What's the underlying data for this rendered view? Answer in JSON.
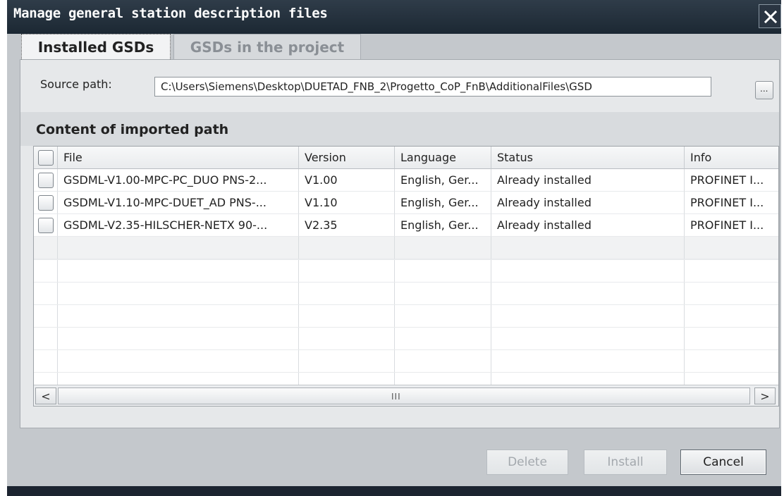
{
  "window": {
    "title": "Manage general station description files"
  },
  "tabs": [
    {
      "label": "Installed GSDs",
      "active": true
    },
    {
      "label": "GSDs in the project",
      "active": false
    }
  ],
  "source": {
    "label": "Source path:",
    "value": "C:\\Users\\Siemens\\Desktop\\DUETAD_FNB_2\\Progetto_CoP_FnB\\AdditionalFiles\\GSD",
    "browse_label": "..."
  },
  "content": {
    "title": "Content of imported path",
    "columns": [
      "File",
      "Version",
      "Language",
      "Status",
      "Info"
    ],
    "rows": [
      {
        "file": "GSDML-V1.00-MPC-PC_DUO PNS-2...",
        "version": "V1.00",
        "language": "English, Ger...",
        "status": "Already installed",
        "info": "PROFINET I..."
      },
      {
        "file": "GSDML-V1.10-MPC-DUET_AD PNS-...",
        "version": "V1.10",
        "language": "English, Ger...",
        "status": "Already installed",
        "info": "PROFINET I..."
      },
      {
        "file": "GSDML-V2.35-HILSCHER-NETX 90-...",
        "version": "V2.35",
        "language": "English, Ger...",
        "status": "Already installed",
        "info": "PROFINET I..."
      }
    ]
  },
  "scrollbar": {
    "left_arrow": "<",
    "right_arrow": ">",
    "grip": "III"
  },
  "buttons": {
    "delete": "Delete",
    "install": "Install",
    "cancel": "Cancel"
  },
  "colors": {
    "titlebar": "#1c2833",
    "dialog_bg": "#c4c8cc",
    "disabled_text": "#a3a8ad"
  }
}
